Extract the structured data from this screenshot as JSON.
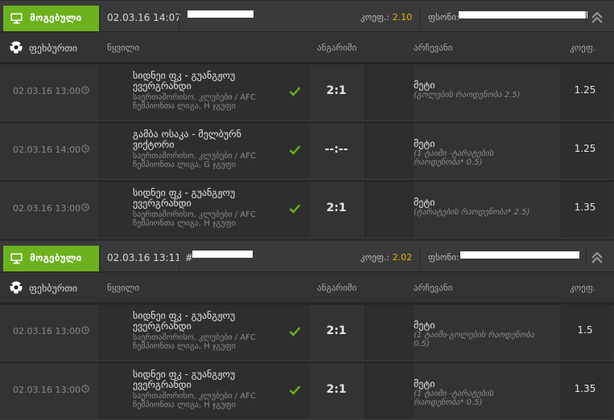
{
  "tickets": [
    {
      "status": "მოგებული",
      "datetime": "02.03.16 14:07",
      "koef_label": "კოეფ.:",
      "koef_value": "2.10",
      "fsoni_label": "ფსონი:",
      "header": {
        "sport": "ფეხბურთი",
        "event": "ნყვილი",
        "score": "ანგარიში",
        "selection": "არჩევანი",
        "odds": "კოეფ."
      },
      "rows": [
        {
          "date": "02.03.16 13:00",
          "teams": "სიდნეი ფკ - გუანგჟოუ ევერგრანდი",
          "league": "საერთაშორისო, კლუბები / AFC ჩემპიონთა ლიგა, H ჯგუფი",
          "score": "2:1",
          "selection": "მეტი",
          "selection_detail": "(გოლების რაოდენობა 2.5)",
          "odds": "1.25",
          "won": true
        },
        {
          "date": "02.03.16 14:00",
          "teams": "გამბა ოსაკა - მელბურნ ვიქტორი",
          "league": "საერთაშორისო, კლუბები / AFC ჩემპიონთა ლიგა, G ჯგუფი",
          "score": "--:--",
          "selection": "მეტი",
          "selection_detail": "(1 ტაიმი -ტარატების რაოდენობა* 0.5)",
          "odds": "1.25",
          "won": true
        },
        {
          "date": "02.03.16 13:00",
          "teams": "სიდნეი ფკ - გუანგჟოუ ევერგრანდი",
          "league": "საერთაშორისო, კლუბები / AFC ჩემპიონთა ლიგა, H ჯგუფი",
          "score": "2:1",
          "selection": "მეტი",
          "selection_detail": "(ტარატების რაოდენობა* 2.5)",
          "odds": "1.35",
          "won": true
        }
      ]
    },
    {
      "status": "მოგებული",
      "datetime": "02.03.16 13:11",
      "id_prefix": "#",
      "koef_label": "კოეფ.:",
      "koef_value": "2.02",
      "fsoni_label": "ფსონი:",
      "header": {
        "sport": "ფეხბურთი",
        "event": "ნყვილი",
        "score": "ანგარიში",
        "selection": "არჩევანი",
        "odds": "კოეფ."
      },
      "rows": [
        {
          "date": "02.03.16 13:00",
          "teams": "სიდნეი ფკ - გუანგჟოუ ევერგრანდი",
          "league": "საერთაშორისო, კლუბები / AFC ჩემპიონთა ლიგა, H ჯგუფი",
          "score": "2:1",
          "selection": "მეტი",
          "selection_detail": "(1 ტაიმი-გოლების რაოდენობა 0.5)",
          "odds": "1.5",
          "won": true
        },
        {
          "date": "02.03.16 13:00",
          "teams": "სიდნეი ფკ - გუანგჟოუ ევერგრანდი",
          "league": "საერთაშორისო, კლუბები / AFC ჩემპიონთა ლიგა, H ჯგუფი",
          "score": "2:1",
          "selection": "მეტი",
          "selection_detail": "(1 ტაიმი -ტარატების რაოდენობა* 0.5)",
          "odds": "1.35",
          "won": true
        }
      ]
    }
  ],
  "colors": {
    "won": "#6cb21f",
    "koef": "#f0b400",
    "background": "#2b2b2b"
  }
}
